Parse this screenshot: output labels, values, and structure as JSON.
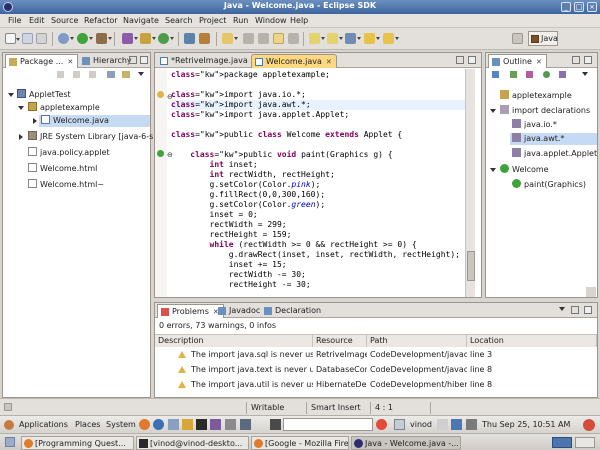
{
  "window": {
    "title": "Java - Welcome.java - Eclipse SDK"
  },
  "menu": [
    "File",
    "Edit",
    "Source",
    "Refactor",
    "Navigate",
    "Search",
    "Project",
    "Run",
    "Window",
    "Help"
  ],
  "perspective": {
    "label": "Java"
  },
  "left_panel": {
    "tabs": [
      "Package ...",
      "Hierarchy"
    ],
    "tree": [
      {
        "label": "AppletTest",
        "icon": "project-icon"
      },
      {
        "label": "appletexample",
        "icon": "package-icon"
      },
      {
        "label": "Welcome.java",
        "icon": "java-file-icon"
      },
      {
        "label": "JRE System Library [java-6-su",
        "icon": "library-icon"
      },
      {
        "label": "java.policy.applet",
        "icon": "file-icon"
      },
      {
        "label": "Welcome.html",
        "icon": "file-icon"
      },
      {
        "label": "Welcome.html~",
        "icon": "file-icon"
      }
    ]
  },
  "editor": {
    "tabs": [
      "*RetriveImage.java",
      "Welcome.java"
    ],
    "code": [
      "package appletexample;",
      "",
      "import java.io.*;",
      "import java.awt.*;",
      "import java.applet.Applet;",
      "",
      "public class Welcome extends Applet {",
      "",
      "    public void paint(Graphics g) {",
      "        int inset;",
      "        int rectWidth, rectHeight;",
      "        g.setColor(Color.pink);",
      "        g.fillRect(0,0,300,160);",
      "        g.setColor(Color.green);",
      "        inset = 0;",
      "        rectWidth = 299;",
      "        rectHeight = 159;",
      "        while (rectWidth >= 0 && rectHeight >= 0) {",
      "            g.drawRect(inset, inset, rectWidth, rectHeight);",
      "            inset += 15;",
      "            rectWidth -= 30;",
      "            rectHeight -= 30;"
    ]
  },
  "outline": {
    "tab": "Outline",
    "items": [
      {
        "label": "appletexample"
      },
      {
        "label": "import declarations"
      },
      {
        "label": "java.io.*"
      },
      {
        "label": "java.awt.*"
      },
      {
        "label": "java.applet.Applet"
      },
      {
        "label": "Welcome"
      },
      {
        "label": "paint(Graphics)"
      }
    ]
  },
  "problems": {
    "tabs": [
      "Problems",
      "Javadoc",
      "Declaration"
    ],
    "summary": "0 errors, 73 warnings, 0 infos",
    "columns": [
      "Description",
      "Resource",
      "Path",
      "Location"
    ],
    "rows": [
      {
        "description": "The import java.sql is never used",
        "resource": "RetriveImage.",
        "path": "CodeDevelopment/javacc",
        "location": "line 3"
      },
      {
        "description": "The import java.text is never use",
        "resource": "DatabaseCon",
        "path": "CodeDevelopment/javacc",
        "location": "line 8"
      },
      {
        "description": "The import java.util is never usec",
        "resource": "HibernateDe",
        "path": "CodeDevelopment/hiberr",
        "location": "line 8"
      }
    ]
  },
  "status": {
    "mode": "Writable",
    "insert": "Smart Insert",
    "position": "4 : 1"
  },
  "gnome_top": {
    "menus": [
      "Applications",
      "Places",
      "System"
    ],
    "user": "vinod",
    "clock": "Thu Sep 25, 10:51 AM"
  },
  "taskbar": [
    {
      "label": "[Programming Quest..."
    },
    {
      "label": "[vinod@vinod-deskto..."
    },
    {
      "label": "[Google - Mozilla Fire..."
    },
    {
      "label": "Java - Welcome.java -..."
    }
  ],
  "colors": {
    "titlebar": "#3d659f",
    "active_editor_tab": "#fdd880",
    "keyword": "#7f0055",
    "selection": "#c7daf4"
  }
}
